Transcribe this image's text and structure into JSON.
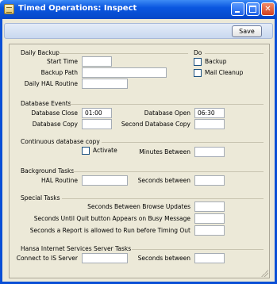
{
  "window": {
    "title": "Timed Operations: Inspect",
    "controls": {
      "minimize": "minimize-icon",
      "maximize": "maximize-icon",
      "close": "close-icon"
    }
  },
  "toolbar": {
    "save_label": "Save"
  },
  "daily_backup": {
    "title": "Daily Backup",
    "start_time_label": "Start Time",
    "start_time_value": "",
    "backup_path_label": "Backup Path",
    "backup_path_value": "",
    "daily_hal_label": "Daily HAL Routine",
    "daily_hal_value": ""
  },
  "do_group": {
    "title": "Do",
    "backup_label": "Backup",
    "backup_checked": false,
    "mail_cleanup_label": "Mail Cleanup",
    "mail_cleanup_checked": false
  },
  "database_events": {
    "title": "Database Events",
    "close_label": "Database Close",
    "close_value": "01:00",
    "open_label": "Database Open",
    "open_value": "06:30",
    "copy_label": "Database Copy",
    "copy_value": "",
    "second_copy_label": "Second Database Copy",
    "second_copy_value": ""
  },
  "continuous_copy": {
    "title": "Continuous database copy",
    "activate_label": "Activate",
    "activate_checked": false,
    "minutes_label": "Minutes Between",
    "minutes_value": ""
  },
  "background_tasks": {
    "title": "Background Tasks",
    "hal_label": "HAL Routine",
    "hal_value": "",
    "seconds_label": "Seconds between",
    "seconds_value": ""
  },
  "special_tasks": {
    "title": "Special Tasks",
    "browse_label": "Seconds Between Browse Updates",
    "browse_value": "",
    "quit_label": "Seconds Until Quit button Appears on Busy Message",
    "quit_value": "",
    "report_label": "Seconds a Report is allowed to Run before Timing Out",
    "report_value": ""
  },
  "his_tasks": {
    "title": "Hansa Internet Services Server Tasks",
    "connect_label": "Connect to IS Server",
    "connect_value": "",
    "seconds_label": "Seconds between",
    "seconds_value": ""
  },
  "colors": {
    "titlebar": "#0a56e0",
    "client": "#ece9d8",
    "toolbar": "#c9d8ef"
  }
}
